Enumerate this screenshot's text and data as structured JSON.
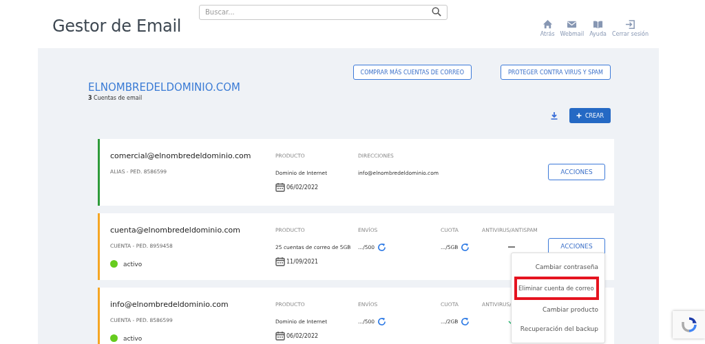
{
  "header": {
    "title": "Gestor de Email",
    "search": {
      "placeholder": "Buscar..."
    },
    "nav": [
      {
        "kind": "home",
        "label": "Atrás"
      },
      {
        "kind": "mail",
        "label": "Webmail"
      },
      {
        "kind": "book",
        "label": "Ayuda"
      },
      {
        "kind": "exit",
        "label": "Cerrar sesión"
      }
    ]
  },
  "panel": {
    "top_buttons": [
      "COMPRAR MÁS CUENTAS DE CORREO",
      "PROTEGER CONTRA VIRUS Y SPAM"
    ],
    "domain": "ELNOMBREDELDOMINIO.COM",
    "count": "**3** Cuentas de email",
    "create_button": "CREAR",
    "accounts": [
      {
        "email": "comercial@elnombredeldominio.com",
        "subtitle": "ALIAS - PED. 8586599",
        "color": "#2e9b3a",
        "product": {
          "label": "PRODUCTO",
          "value": "Dominio de Internet",
          "date": "06/02/2022"
        },
        "fields": [
          {
            "kind": "text",
            "label": "DIRECCIONES",
            "value": "info@elnombredeldominio.com"
          }
        ],
        "actions": "ACCIONES"
      },
      {
        "email": "cuenta@elnombredeldominio.com",
        "subtitle": "CUENTA - PED. 8959458",
        "color": "#f5a623",
        "status": {
          "label": "activo",
          "color": "#66cc1e"
        },
        "product": {
          "label": "PRODUCTO",
          "value": "25 cuentas de correo de 5GB",
          "date": "11/09/2021"
        },
        "fields": [
          {
            "kind": "counter",
            "label": "ENVÍOS",
            "value": ".../500"
          },
          {
            "kind": "counter",
            "label": "CUOTA",
            "value": ".../5GB"
          },
          {
            "kind": "dash",
            "label": "ANTIVIRUS/ANTISPAM"
          }
        ],
        "actions": "ACCIONES",
        "menu": [
          {
            "label": "Cambiar contraseña",
            "highlighted": false
          },
          {
            "label": "Eliminar cuenta de correo",
            "highlighted": true
          },
          {
            "label": "Cambiar producto",
            "highlighted": false
          },
          {
            "label": "Recuperación del backup",
            "highlighted": false
          }
        ]
      },
      {
        "email": "info@elnombredeldominio.com",
        "subtitle": "CUENTA - PED. 8586599",
        "color": "#f5a623",
        "status": {
          "label": "activo",
          "color": "#66cc1e"
        },
        "product": {
          "label": "PRODUCTO",
          "value": "Dominio de Internet",
          "date": "06/02/2022"
        },
        "fields": [
          {
            "kind": "counter",
            "label": "ENVÍOS",
            "value": ".../500"
          },
          {
            "kind": "counter",
            "label": "CUOTA",
            "value": ".../2GB"
          },
          {
            "kind": "check",
            "label": "ANTIVIRUS/"
          }
        ]
      }
    ]
  }
}
